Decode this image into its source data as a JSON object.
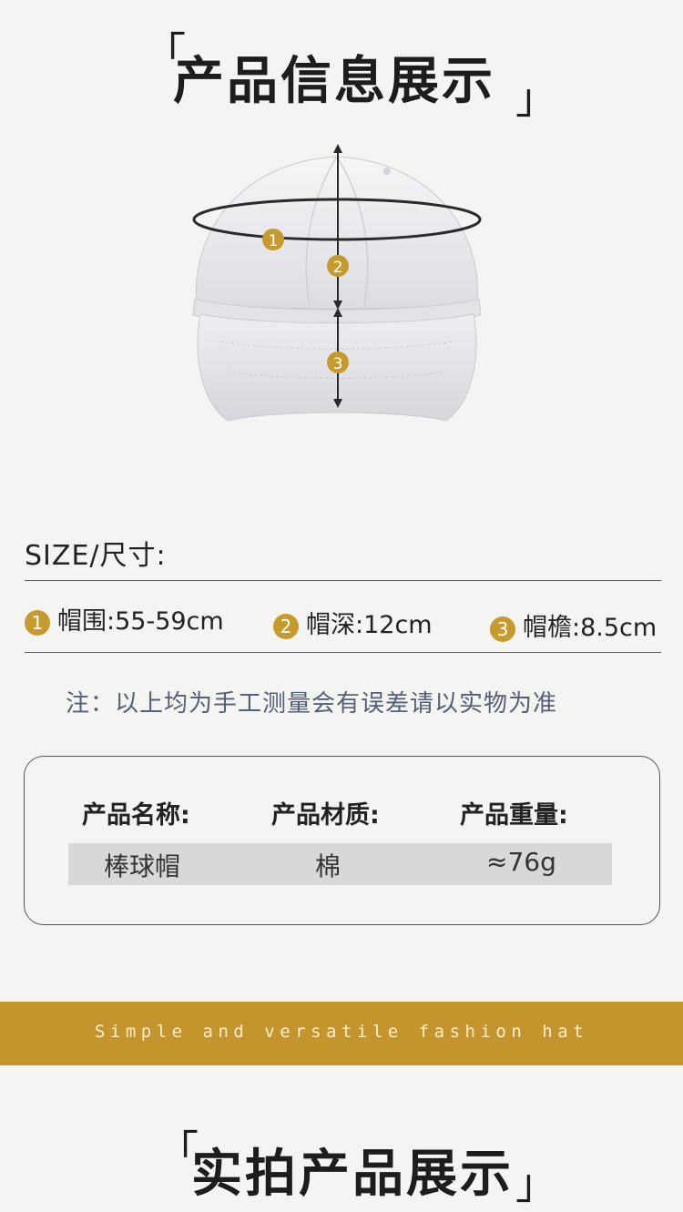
{
  "header": {
    "open_bracket": "「",
    "title": "产品信息展示",
    "close_bracket": "」"
  },
  "diagram": {
    "markers": [
      "1",
      "2",
      "3"
    ],
    "accent_color": "#c79a2d"
  },
  "size": {
    "label": "SIZE/尺寸:",
    "items": [
      {
        "num": "1",
        "text": "帽围:55-59cm"
      },
      {
        "num": "2",
        "text": "帽深:12cm"
      },
      {
        "num": "3",
        "text": "帽檐:8.5cm"
      }
    ]
  },
  "note": "注：以上均为手工测量会有误差请以实物为准",
  "info": {
    "headers": [
      "产品名称:",
      "产品材质:",
      "产品重量:"
    ],
    "values": [
      "棒球帽",
      "棉",
      "≈76g"
    ]
  },
  "banner": {
    "text": "Simple and versatile fashion hat",
    "color": "#c4952d"
  },
  "footer": {
    "open_bracket": "「",
    "title": "实拍产品展示",
    "close_bracket": "」"
  }
}
